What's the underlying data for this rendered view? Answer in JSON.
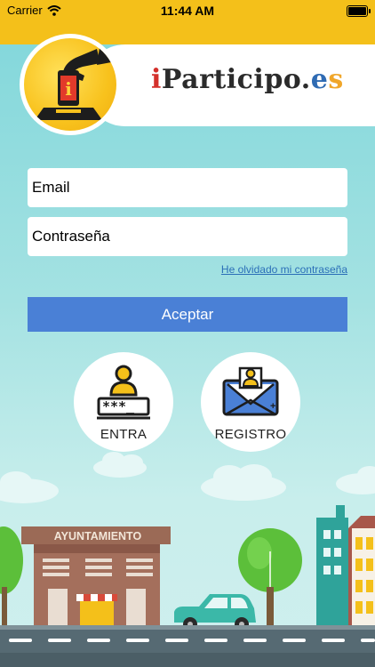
{
  "status_bar": {
    "carrier": "Carrier",
    "time": "11:44 AM",
    "wifi_icon": "wifi-icon",
    "battery_icon": "battery-icon"
  },
  "header": {
    "logo_icon": "hand-voting-icon",
    "title_i": "i",
    "title_main": "Participo.",
    "title_e": "e",
    "title_s": "s"
  },
  "form": {
    "email_placeholder": "Email",
    "email_value": "",
    "password_placeholder": "Contraseña",
    "password_value": "",
    "forgot_label": "He olvidado mi contraseña",
    "submit_label": "Aceptar"
  },
  "actions": {
    "login_label": "ENTRA",
    "login_icon": "user-password-icon",
    "register_label": "REGISTRO",
    "register_icon": "user-envelope-icon"
  },
  "scene": {
    "building_sign": "AYUNTAMIENTO"
  },
  "colors": {
    "brand_yellow": "#f4c01a",
    "button_blue": "#4a80d6",
    "sky": "#a4e2e2",
    "link_blue": "#2b6fb8"
  }
}
